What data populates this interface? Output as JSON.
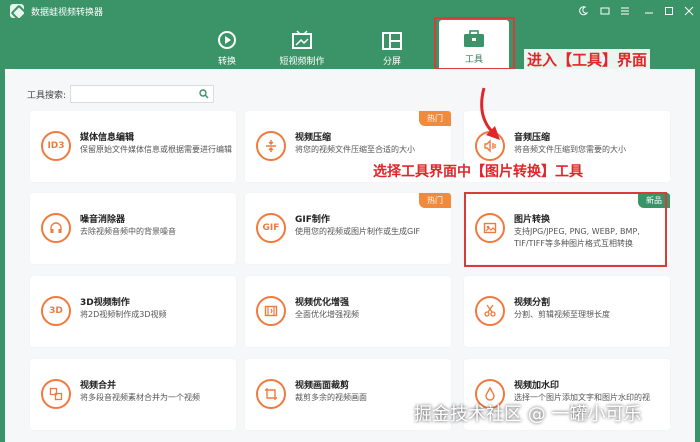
{
  "window": {
    "title": "数据蛙视频转换器"
  },
  "tabs": [
    {
      "label": "转换",
      "icon": "convert-icon"
    },
    {
      "label": "短视频制作",
      "icon": "video-making-icon"
    },
    {
      "label": "分屏",
      "icon": "split-screen-icon"
    },
    {
      "label": "工具",
      "icon": "toolbox-icon",
      "active": true
    }
  ],
  "annotations": {
    "enter_tools": "进入【工具】界面",
    "select_image": "选择工具界面中【图片转换】工具"
  },
  "search": {
    "label": "工具搜索:",
    "placeholder": ""
  },
  "cards": [
    {
      "title": "媒体信息编辑",
      "desc": "保留原始文件媒体信息或根据需要进行编辑",
      "icon": "ID3",
      "badge": ""
    },
    {
      "title": "视频压缩",
      "desc": "将您的视频文件压缩至合适的大小",
      "icon": "compress",
      "badge": "热门"
    },
    {
      "title": "音频压缩",
      "desc": "将音频文件压缩到您需要的大小",
      "icon": "audio",
      "badge": ""
    },
    {
      "title": "噪音消除器",
      "desc": "去除视频音频中的背景噪音",
      "icon": "noise",
      "badge": ""
    },
    {
      "title": "GIF制作",
      "desc": "使用您的视频或图片制作或生成GIF",
      "icon": "GIF",
      "badge": "热门"
    },
    {
      "title": "图片转换",
      "desc": "支持JPG/JPEG, PNG, WEBP, BMP, TIF/TIFF等多种图片格式互相转换",
      "icon": "image",
      "badge": "新品"
    },
    {
      "title": "3D视频制作",
      "desc": "将2D视频制作成3D视频",
      "icon": "3D",
      "badge": ""
    },
    {
      "title": "视频优化增强",
      "desc": "全面优化增强视频",
      "icon": "enhance",
      "badge": ""
    },
    {
      "title": "视频分割",
      "desc": "分割、剪辑视频至理想长度",
      "icon": "split",
      "badge": ""
    },
    {
      "title": "视频合并",
      "desc": "将多段音视频素材合并为一个视频",
      "icon": "merge",
      "badge": ""
    },
    {
      "title": "视频画面裁剪",
      "desc": "裁剪多余的视频画面",
      "icon": "crop",
      "badge": ""
    },
    {
      "title": "视频加水印",
      "desc": "选择一个图片添加文字和图片水印的视",
      "icon": "watermark",
      "badge": ""
    }
  ],
  "watermark": "掘金技术社区 @ 一罐小可乐",
  "colors": {
    "brand": "#3a9467",
    "accent": "#f07a3e",
    "highlight": "#d93b3b"
  }
}
